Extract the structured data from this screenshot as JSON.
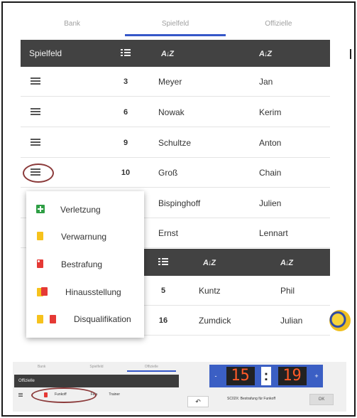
{
  "tabs": [
    "Bank",
    "Spielfeld",
    "Offizielle"
  ],
  "table": {
    "header_label": "Spielfeld",
    "rows": [
      {
        "number": "3",
        "last": "Meyer",
        "first": "Jan"
      },
      {
        "number": "6",
        "last": "Nowak",
        "first": "Kerim"
      },
      {
        "number": "9",
        "last": "Schultze",
        "first": "Anton"
      },
      {
        "number": "10",
        "last": "Groß",
        "first": "Chain"
      },
      {
        "number": "",
        "last": "Bispinghoff",
        "first": "Julien"
      },
      {
        "number": "",
        "last": "Ernst",
        "first": "Lennart"
      }
    ]
  },
  "table2": {
    "rows": [
      {
        "number": "5",
        "last": "Kuntz",
        "first": "Phil"
      },
      {
        "number": "16",
        "last": "Zumdick",
        "first": "Julian"
      }
    ]
  },
  "menu": {
    "items": [
      {
        "label": "Verletzung",
        "icon": "green-plus-card-icon"
      },
      {
        "label": "Verwarnung",
        "icon": "yellow-card-icon"
      },
      {
        "label": "Bestrafung",
        "icon": "red-card-icon"
      },
      {
        "label": "Hinausstellung",
        "icon": "yellow-red-card-icon"
      },
      {
        "label": "Disqualifikation",
        "icon": "yellow-and-red-card-icon"
      }
    ]
  },
  "mini": {
    "tabs": [
      "Bank",
      "Spielfeld",
      "Offizielle"
    ],
    "header": "Offizielle",
    "row_cells": [
      "Funkoff",
      "Fela",
      "Trainer"
    ],
    "timer_minutes": "15",
    "timer_seconds": "19",
    "timer_colon": ":",
    "minus_label": "-",
    "plus_label": "+",
    "undo_label": "↶",
    "status": "SC02X: Bestrafung für Funkoff",
    "button_label": "OK"
  },
  "colors": {
    "accent": "#3557c8",
    "header_bg": "#424242",
    "timer_digits": "#ff5a28",
    "highlight_oval": "#8b3a3a"
  }
}
